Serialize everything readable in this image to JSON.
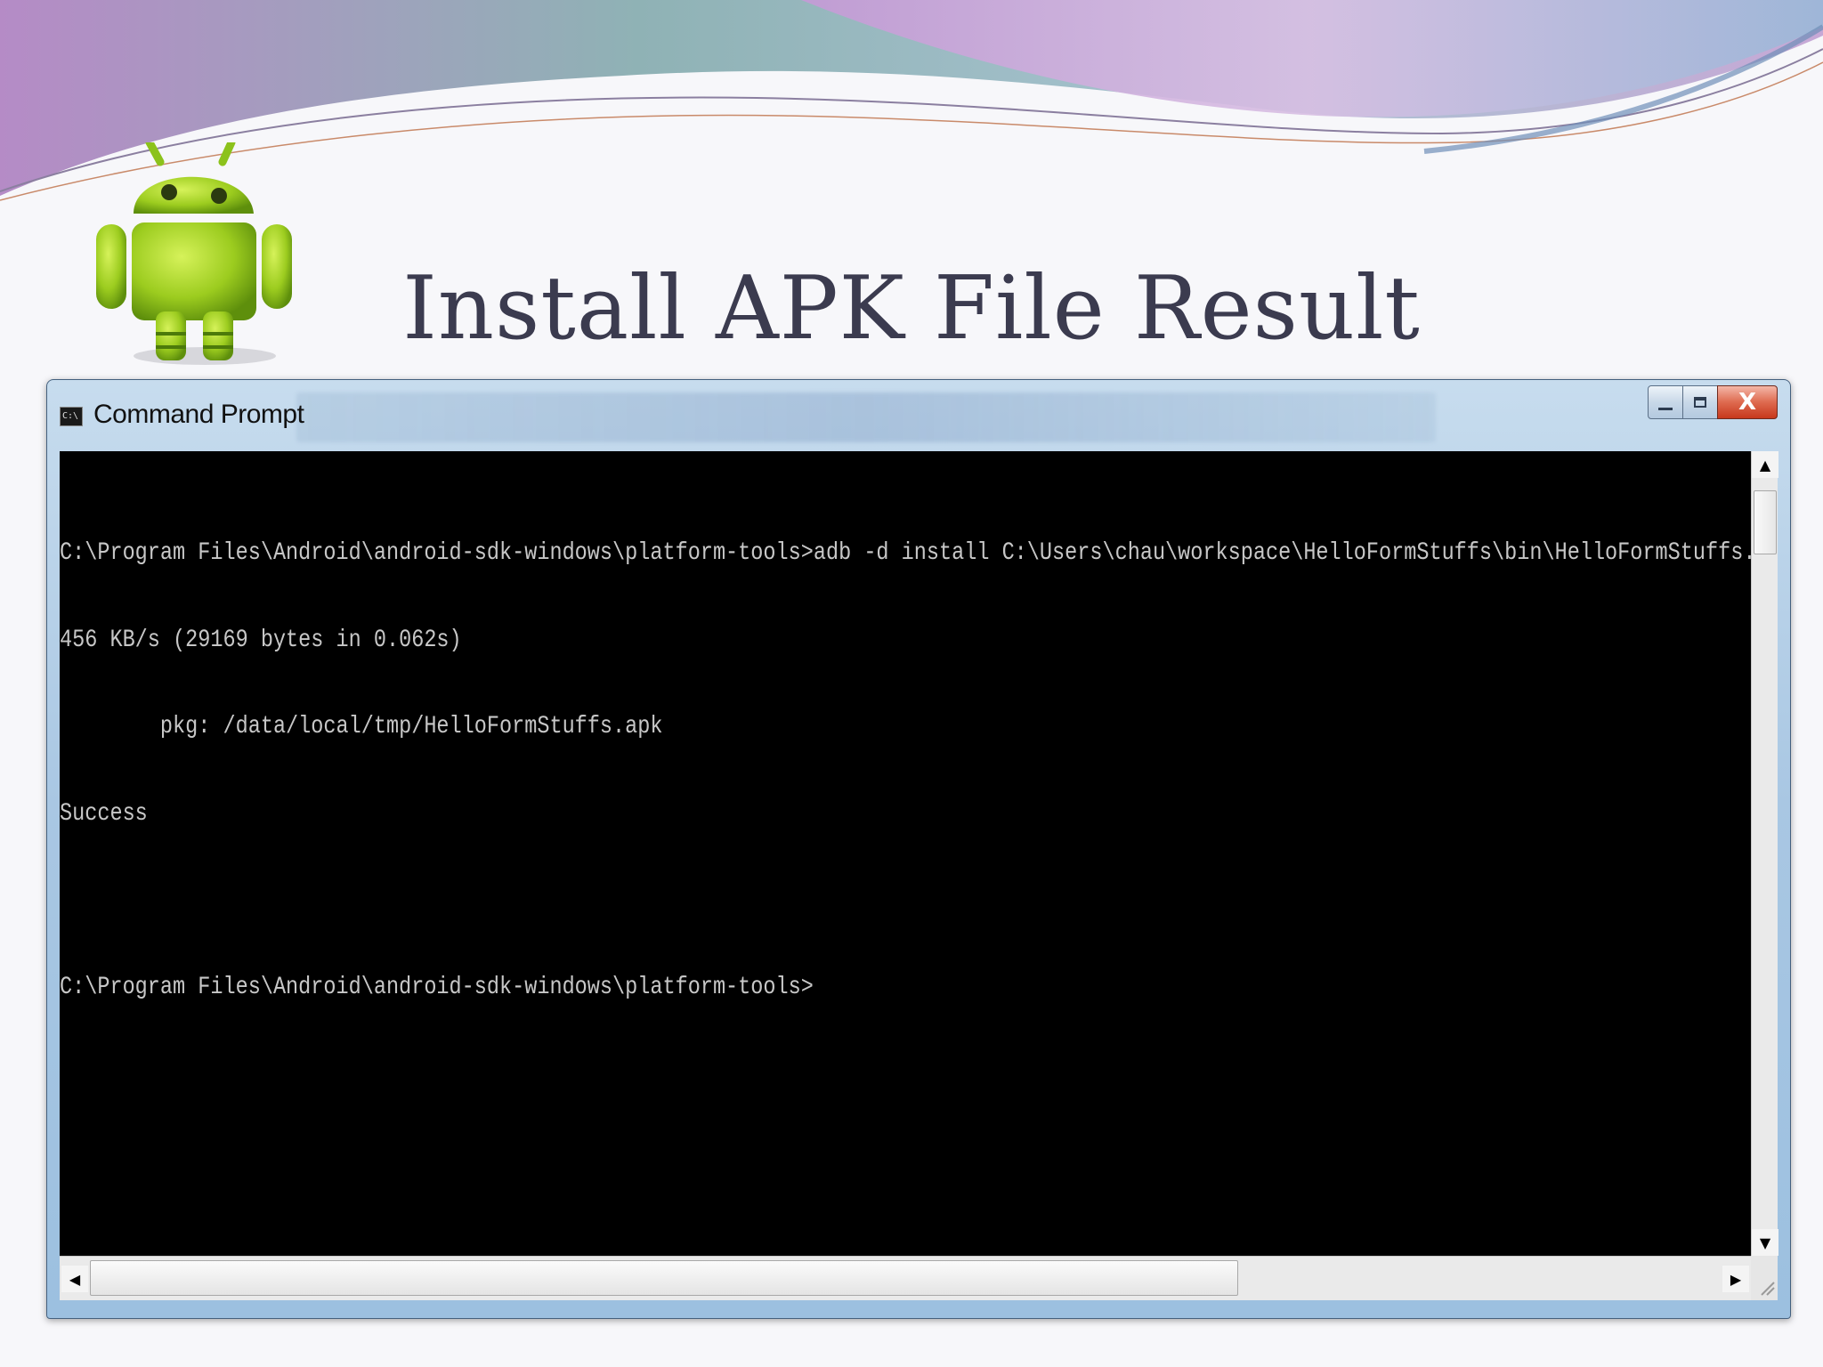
{
  "slide": {
    "title": "Install APK File Result",
    "logo_icon": "android-robot-icon"
  },
  "window": {
    "title": "Command Prompt",
    "icon_text": "C:\\",
    "buttons": {
      "minimize_icon": "minimize-icon",
      "maximize_icon": "maximize-icon",
      "close_label": "X"
    }
  },
  "console": {
    "lines": [
      "C:\\Program Files\\Android\\android-sdk-windows\\platform-tools>adb -d install C:\\Users\\chau\\workspace\\HelloFormStuffs\\bin\\HelloFormStuffs.apk",
      "456 KB/s (29169 bytes in 0.062s)",
      "        pkg: /data/local/tmp/HelloFormStuffs.apk",
      "Success",
      "",
      "C:\\Program Files\\Android\\android-sdk-windows\\platform-tools>"
    ]
  },
  "scrollbars": {
    "up_arrow": "▲",
    "down_arrow": "▼",
    "left_arrow": "◀",
    "right_arrow": "▶"
  },
  "colors": {
    "console_bg": "#000000",
    "console_text": "#c7c7c7",
    "title_text": "#3b3b4f",
    "android_green": "#9ccc1f"
  }
}
